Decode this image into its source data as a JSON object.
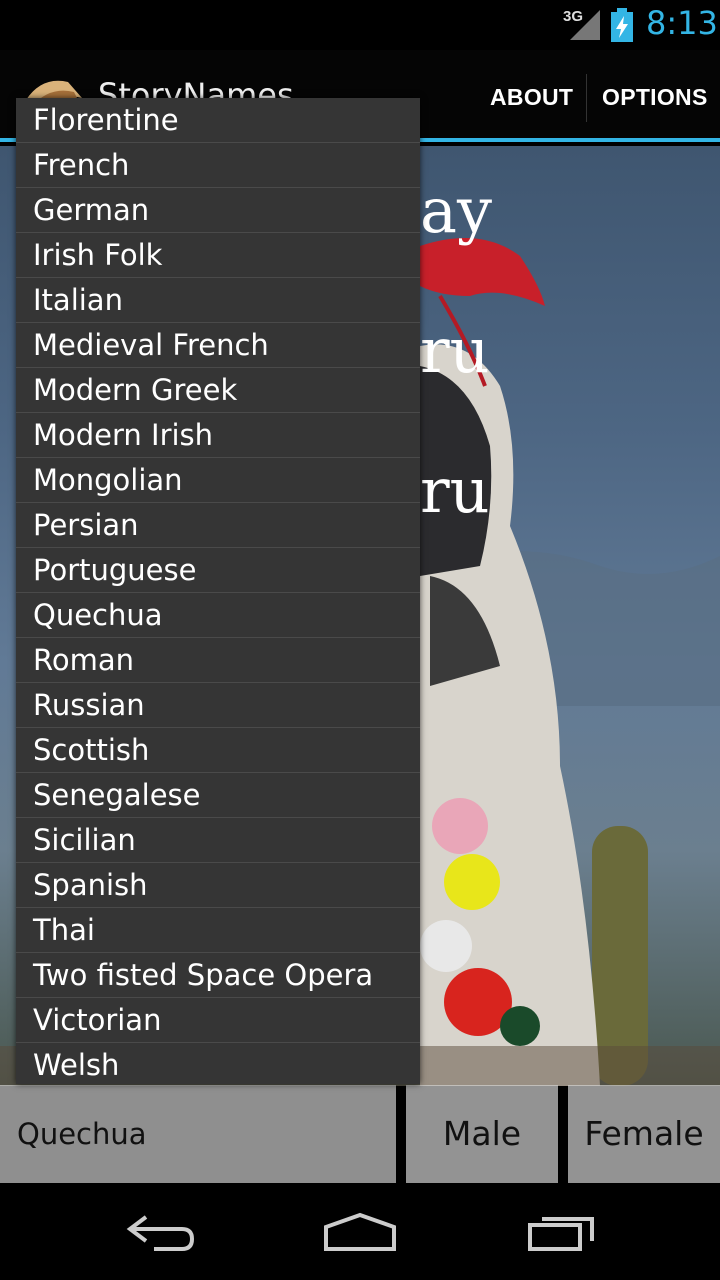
{
  "status_bar": {
    "network": "3G",
    "time": "8:13"
  },
  "action_bar": {
    "app_title": "StoryNames",
    "about": "ABOUT",
    "options": "OPTIONS"
  },
  "background_text": {
    "line1": "ay",
    "line2": "ru",
    "line3": "ru"
  },
  "dropdown": {
    "items": [
      "Florentine",
      "French",
      "German",
      "Irish Folk",
      "Italian",
      "Medieval French",
      "Modern Greek",
      "Modern Irish",
      "Mongolian",
      "Persian",
      "Portuguese",
      "Quechua",
      "Roman",
      "Russian",
      "Scottish",
      "Senegalese",
      "Sicilian",
      "Spanish",
      "Thai",
      "Two fisted Space Opera",
      "Victorian",
      "Welsh"
    ]
  },
  "selection": {
    "origin": "Quechua",
    "male": "Male",
    "female": "Female"
  },
  "nav": {
    "back_icon": "back-icon",
    "home_icon": "home-icon",
    "recents_icon": "recents-icon"
  }
}
